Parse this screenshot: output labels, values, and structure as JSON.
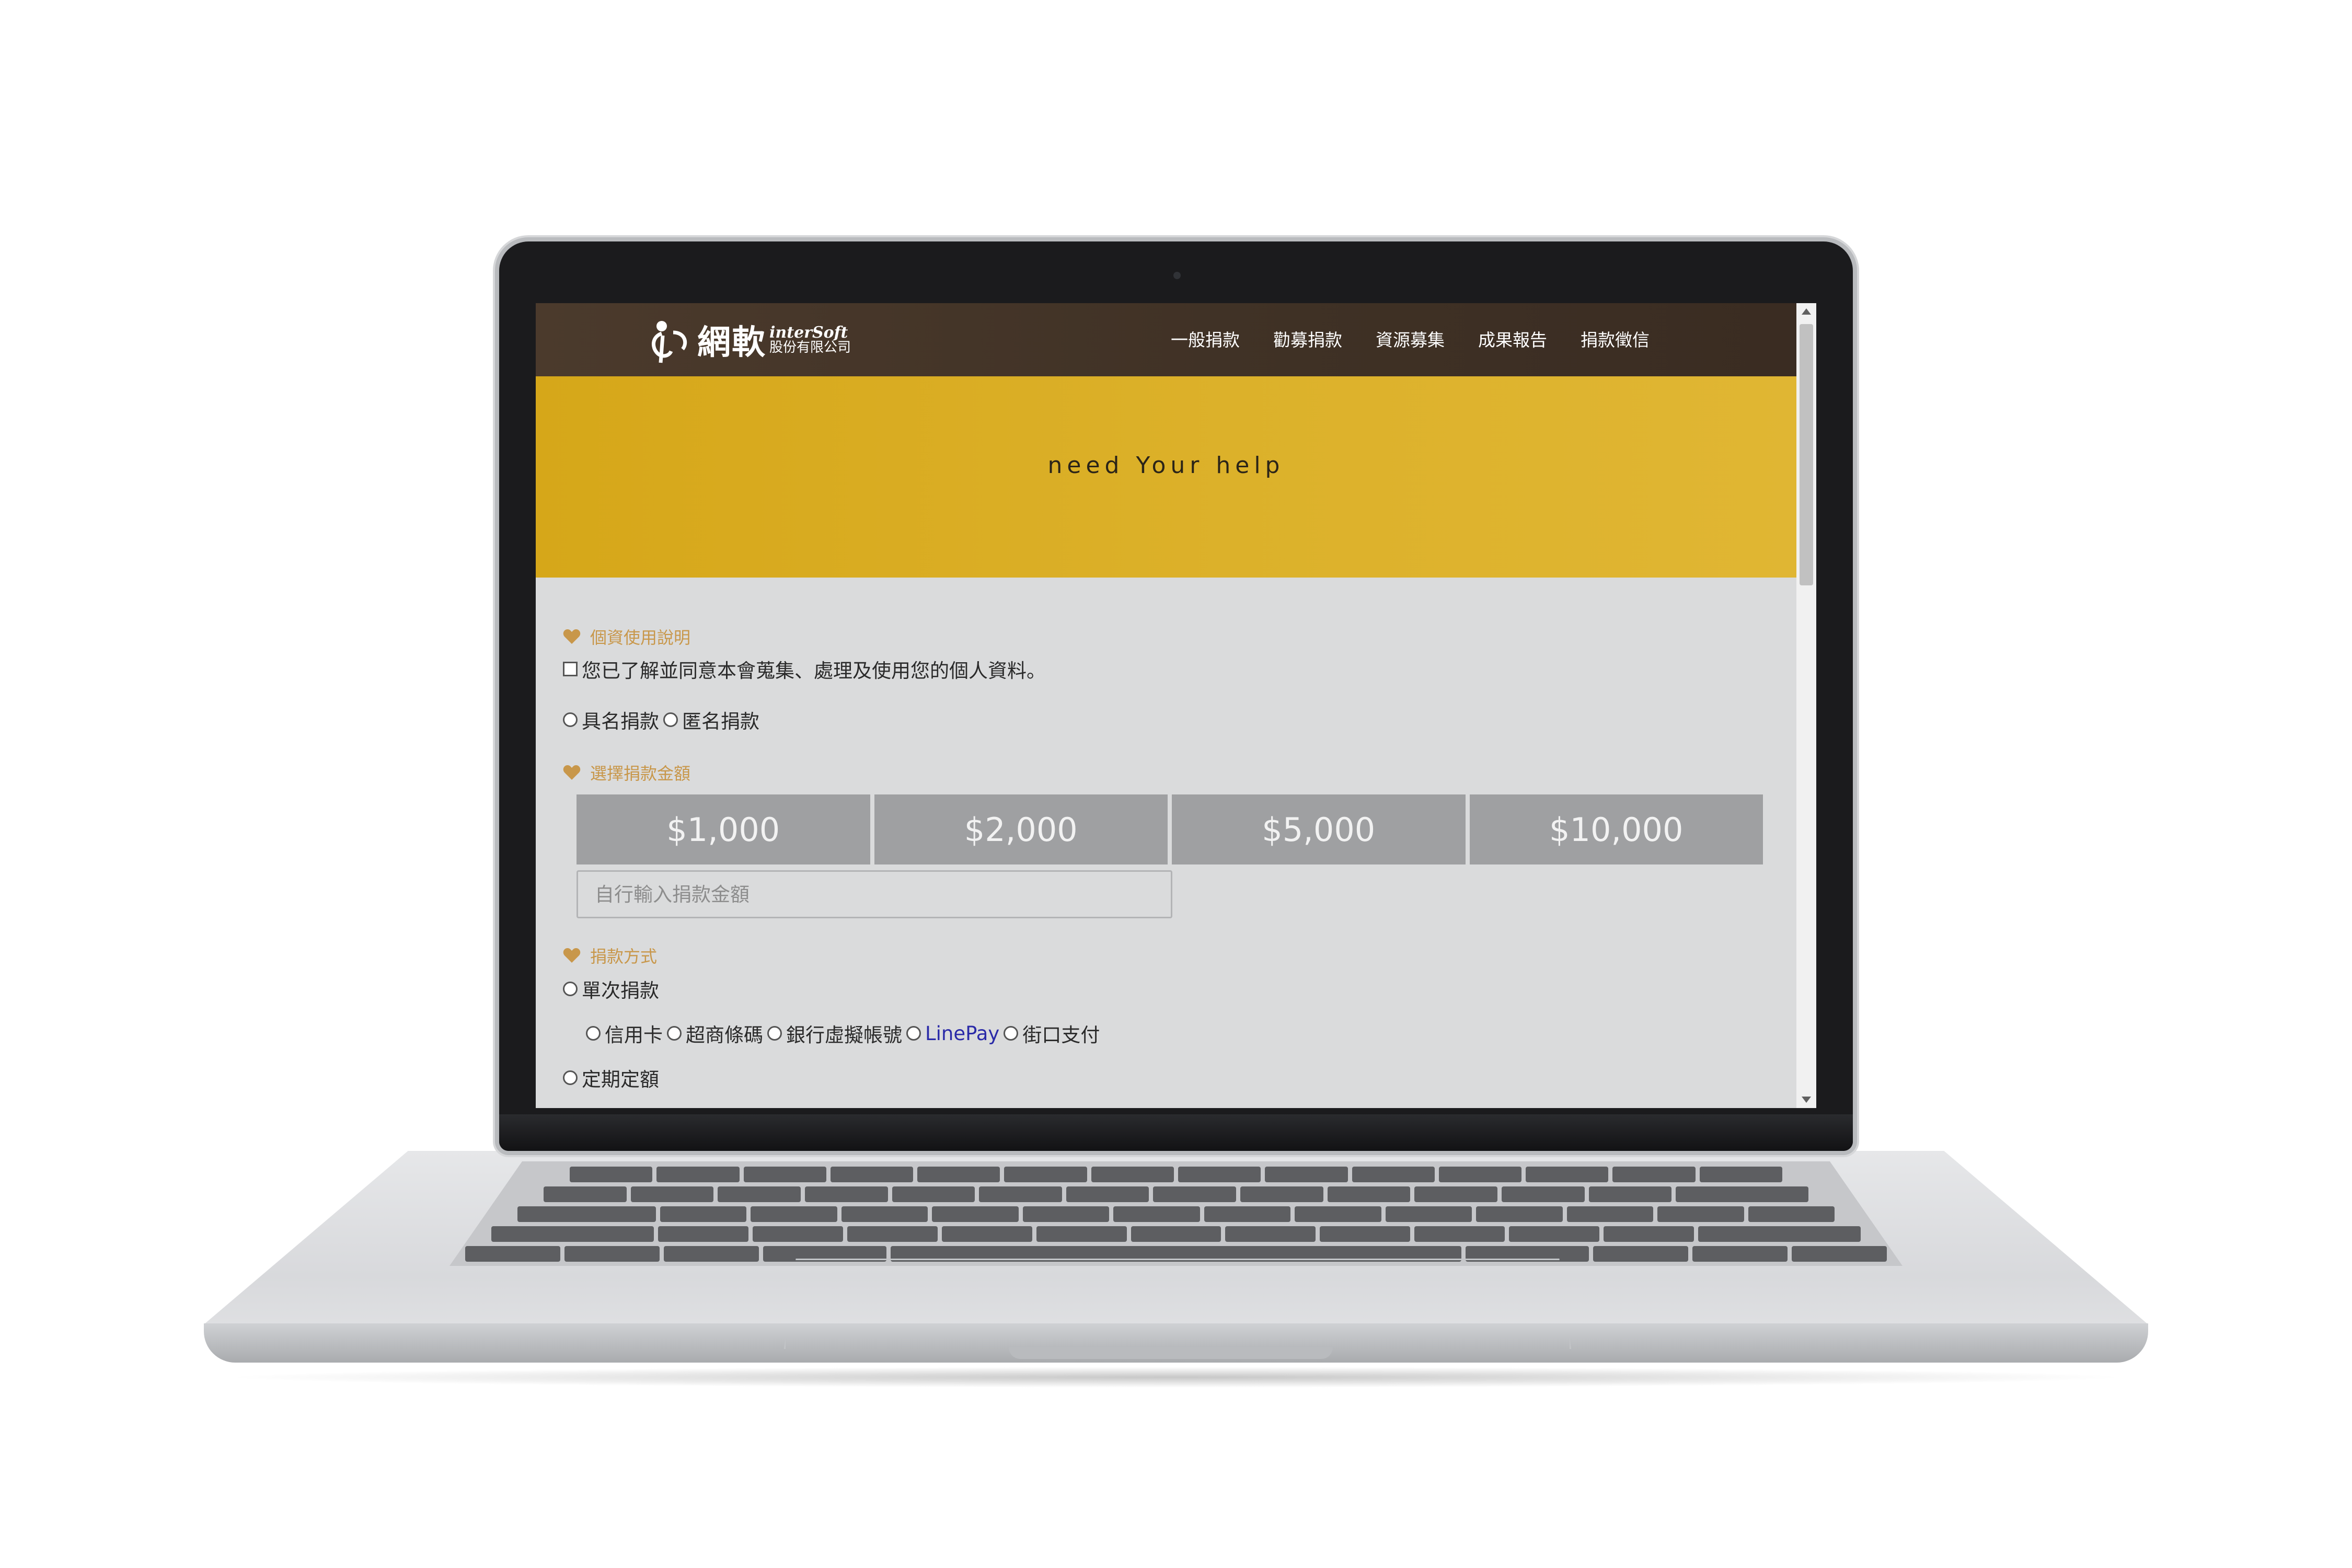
{
  "window": {
    "device": "laptop-mockup"
  },
  "brand": {
    "logo_name": "網軟",
    "logo_en": "interSoft",
    "logo_company": "股份有限公司",
    "nav_bg": "#3f3125",
    "hero_bg": "#d9ad22",
    "accent": "#c8974a"
  },
  "nav": {
    "items": [
      {
        "label": "一般捐款"
      },
      {
        "label": "勸募捐款"
      },
      {
        "label": "資源募集"
      },
      {
        "label": "成果報告"
      },
      {
        "label": "捐款徵信"
      }
    ]
  },
  "hero": {
    "text": "need Your help"
  },
  "privacy": {
    "heading": "個資使用說明",
    "consent_label": "您已了解並同意本會蒐集、處理及使用您的個人資料。"
  },
  "identity": {
    "options": [
      {
        "label": "具名捐款"
      },
      {
        "label": "匿名捐款"
      }
    ]
  },
  "amount": {
    "heading": "選擇捐款金額",
    "options": [
      {
        "label": "$1,000"
      },
      {
        "label": "$2,000"
      },
      {
        "label": "$5,000"
      },
      {
        "label": "$10,000"
      }
    ],
    "custom_placeholder": "自行輸入捐款金額"
  },
  "method": {
    "heading": "捐款方式",
    "single_label": "單次捐款",
    "payment_options": [
      {
        "label": "信用卡"
      },
      {
        "label": "超商條碼"
      },
      {
        "label": "銀行虛擬帳號"
      },
      {
        "label": "LinePay"
      },
      {
        "label": "街口支付"
      }
    ],
    "recurring_label": "定期定額"
  },
  "icons": {
    "section_marker": "heart-icon",
    "logo_mark": "person-logo-icon"
  }
}
